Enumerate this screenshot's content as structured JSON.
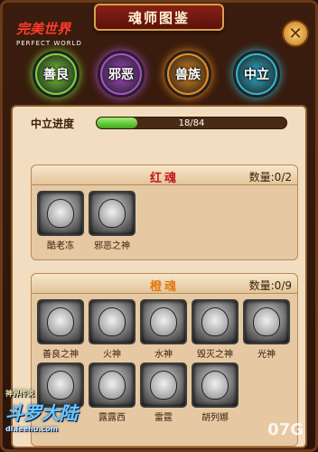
{
  "header": {
    "title": "魂师图鉴"
  },
  "logo": {
    "main": "完美世界",
    "sub": "PERFECT WORLD"
  },
  "close_glyph": "✕",
  "categories": [
    {
      "label": "善良",
      "color": "#7ad63a"
    },
    {
      "label": "邪恶",
      "color": "#b04ad6"
    },
    {
      "label": "兽族",
      "color": "#f08a1a"
    },
    {
      "label": "中立",
      "color": "#2ab8d6"
    }
  ],
  "progress": {
    "label": "中立进度",
    "text": "18/84",
    "value": 18,
    "max": 84
  },
  "sections": [
    {
      "title": "红魂",
      "title_color": "#c4161c",
      "count": "数量:0/2",
      "cards": [
        {
          "name": "酷老冻"
        },
        {
          "name": "邪恶之神"
        }
      ]
    },
    {
      "title": "橙魂",
      "title_color": "#e07a10",
      "count": "数量:0/9",
      "cards": [
        {
          "name": "善良之神"
        },
        {
          "name": "火神"
        },
        {
          "name": "水神"
        },
        {
          "name": "毁灭之神"
        },
        {
          "name": "光神"
        },
        {
          "name": ""
        },
        {
          "name": "露露西"
        },
        {
          "name": "雷霆"
        },
        {
          "name": "胡列娜"
        }
      ]
    }
  ],
  "watermark": {
    "sub": "神界传说",
    "title": "斗罗大陆",
    "url": "dl.leehu.com",
    "site": "07G"
  }
}
